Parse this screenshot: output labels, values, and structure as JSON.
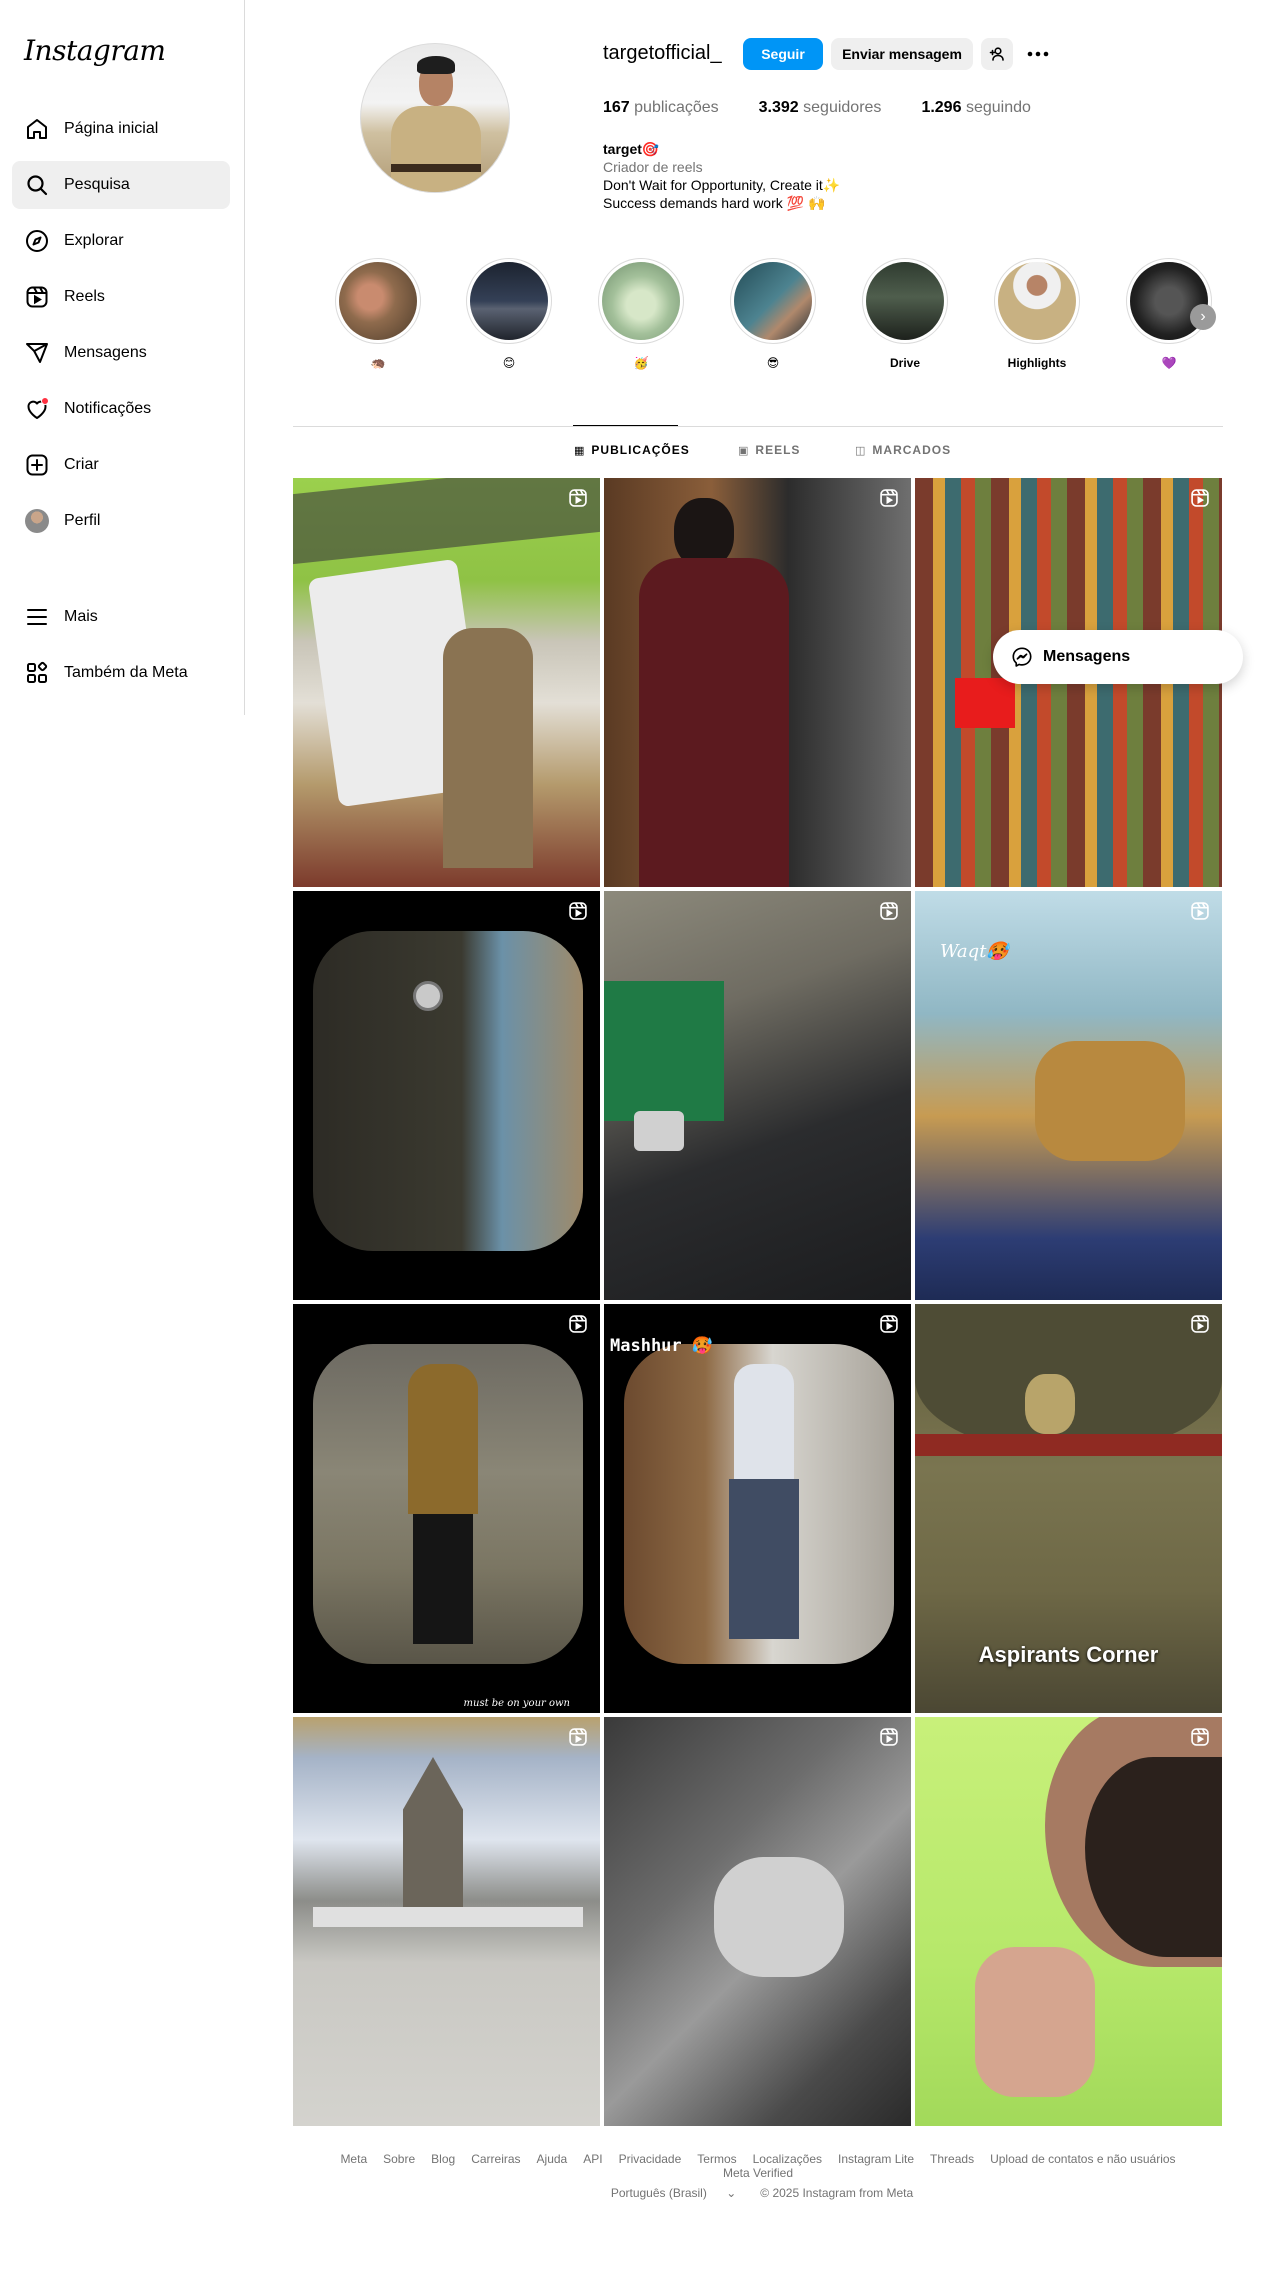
{
  "app": {
    "logo": "Instagram"
  },
  "sidebar": {
    "items": [
      {
        "label": "Página inicial",
        "icon": "home-icon"
      },
      {
        "label": "Pesquisa",
        "icon": "search-icon",
        "active": true
      },
      {
        "label": "Explorar",
        "icon": "compass-icon"
      },
      {
        "label": "Reels",
        "icon": "reels-icon"
      },
      {
        "label": "Mensagens",
        "icon": "send-icon"
      },
      {
        "label": "Notificações",
        "icon": "heart-icon",
        "badge": true
      },
      {
        "label": "Criar",
        "icon": "plus-icon"
      },
      {
        "label": "Perfil",
        "icon": "avatar"
      }
    ],
    "bottom": [
      {
        "label": "Mais",
        "icon": "menu-icon"
      },
      {
        "label": "Também da Meta",
        "icon": "meta-icon"
      }
    ]
  },
  "profile": {
    "username": "targetofficial_",
    "follow_label": "Seguir",
    "message_label": "Enviar mensagem",
    "posts_count": "167",
    "posts_label": "publicações",
    "followers_count": "3.392",
    "followers_label": "seguidores",
    "following_count": "1.296",
    "following_label": "seguindo",
    "name": "target🎯",
    "category": "Criador de reels",
    "bio_line1": "Don't Wait for Opportunity, Create it✨",
    "bio_line2": "Success demands hard work 💯 🙌"
  },
  "highlights": [
    {
      "label": "🦔"
    },
    {
      "label": "😊"
    },
    {
      "label": "🥳"
    },
    {
      "label": "😎"
    },
    {
      "label": "Drive"
    },
    {
      "label": "Highlights"
    },
    {
      "label": "💜"
    }
  ],
  "tabs": [
    {
      "label": "PUBLICAÇÕES",
      "icon": "grid-icon",
      "active": true
    },
    {
      "label": "REELS",
      "icon": "reels-icon"
    },
    {
      "label": "MARCADOS",
      "icon": "tagged-icon"
    }
  ],
  "posts": {
    "overlay_text_6": "Waqt🥵",
    "overlay_text_8": "Mashhur 🥵",
    "overlay_text_9": "Aspirants Corner",
    "overlay_text_7": "must be on your own"
  },
  "floating_messages": {
    "label": "Mensagens"
  },
  "footer": {
    "links": [
      "Meta",
      "Sobre",
      "Blog",
      "Carreiras",
      "Ajuda",
      "API",
      "Privacidade",
      "Termos",
      "Localizações",
      "Instagram Lite",
      "Threads",
      "Upload de contatos e não usuários",
      "Meta Verified"
    ],
    "language": "Português (Brasil)",
    "copyright": "© 2025 Instagram from Meta"
  }
}
